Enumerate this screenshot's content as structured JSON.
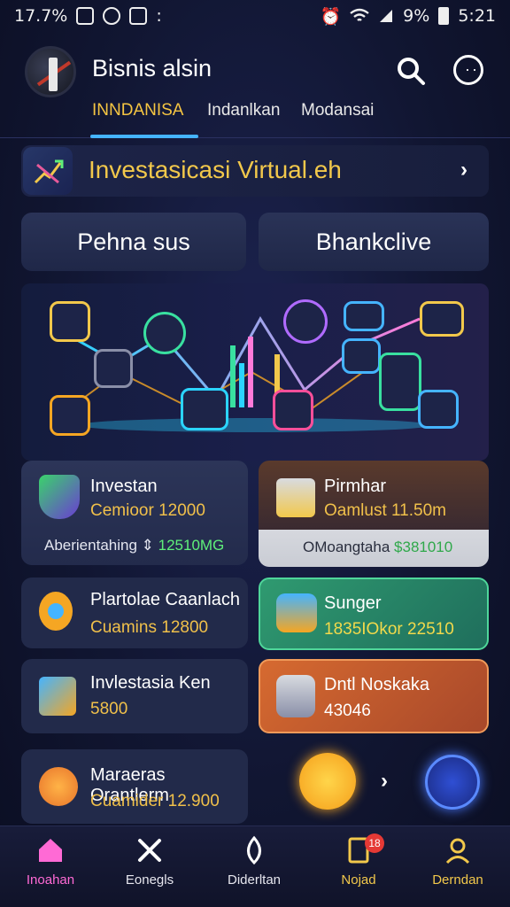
{
  "status_bar": {
    "left_text": "17.7%",
    "battery": "9%",
    "time": "5:21",
    "left_icons": [
      "notification-icon",
      "circle-app-icon",
      "image-icon"
    ],
    "right_icons": [
      "alarm-icon",
      "wifi-icon",
      "signal-icon",
      "battery-icon"
    ]
  },
  "header": {
    "title": "Bisnis alsin",
    "icons": [
      "search-icon",
      "profile-icon"
    ]
  },
  "tabs": [
    {
      "label": "INNDANISA",
      "active": true
    },
    {
      "label": "Indanlkan",
      "active": false
    },
    {
      "label": "Modansai",
      "active": false
    }
  ],
  "banner": {
    "title": "Investasicasi Virtual.eh",
    "icon": "chart-growth-icon"
  },
  "sections": {
    "left": "Pehna sus",
    "right": "Bhankclive"
  },
  "feature_cards": [
    {
      "title": "Investan",
      "subtitle": "Cemioor 12000",
      "footer_label": "Aberientahing",
      "footer_value": "12510MG",
      "icon": "shield-icon"
    },
    {
      "title": "Pirmhar",
      "subtitle": "Oamlust 11.50m",
      "footer_label": "OMoangtaha",
      "footer_value": "$381010",
      "icon": "coins-stack-icon"
    }
  ],
  "list_cards_left": [
    {
      "title": "Plartolae Caanlach",
      "subtitle": "Cuamins 12800",
      "icon": "badge-icon"
    },
    {
      "title": "Invlestasia Ken",
      "subtitle": "5800",
      "icon": "card-icon"
    },
    {
      "title": "Maraeras Orantlerm",
      "subtitle": "Cuamider 12.900",
      "icon": "coin-icon"
    }
  ],
  "list_cards_right": [
    {
      "title": "Sunger",
      "subtitle": "1835IOkor 22510",
      "icon": "treasure-icon"
    },
    {
      "title": "Dntl Noskaka",
      "subtitle": "43046",
      "icon": "robot-arm-icon"
    }
  ],
  "float_buttons": [
    "wallet-icon",
    "camera-icon"
  ],
  "colors": {
    "accent_gold": "#f2c84b",
    "accent_blue": "#45b4ff",
    "positive_green": "#5ff07a",
    "card_teal": "#2a8a6a",
    "card_orange": "#c9602c"
  },
  "bottom_nav": [
    {
      "label": "Inoahan",
      "icon": "home-icon",
      "active": true
    },
    {
      "label": "Eonegls",
      "icon": "tools-icon",
      "active": false
    },
    {
      "label": "Diderltan",
      "icon": "drop-icon",
      "active": false
    },
    {
      "label": "Nojad",
      "icon": "document-icon",
      "active": false,
      "badge": "18"
    },
    {
      "label": "Derndan",
      "icon": "user-icon",
      "active": false
    }
  ]
}
